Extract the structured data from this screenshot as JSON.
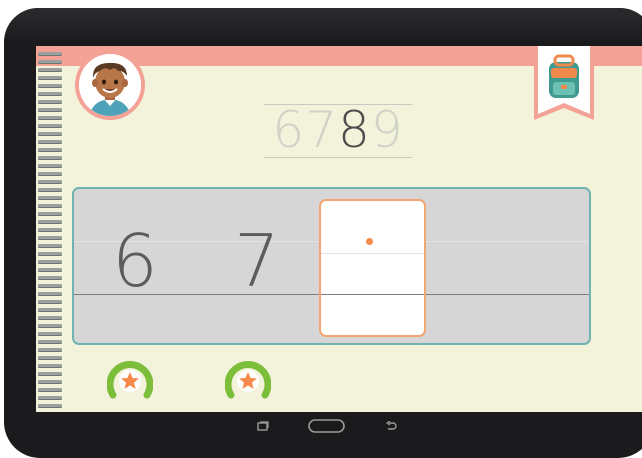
{
  "sequence": {
    "digits": [
      "6",
      "7",
      "8",
      "9"
    ],
    "current_index": 2
  },
  "writing": {
    "written": [
      "6",
      "7"
    ],
    "target_digit": "8"
  },
  "stars": {
    "earned": 2
  },
  "nav": {
    "buttons": [
      "recent-apps",
      "home",
      "back"
    ]
  },
  "icons": {
    "avatar": "boy-avatar-icon",
    "backpack": "backpack-icon",
    "star": "star-icon"
  },
  "colors": {
    "header_band": "#f4a196",
    "screen_bg": "#f3f2da",
    "panel_border": "#6fb4b0",
    "tracebox_border": "#f3a574",
    "star_ring": "#7cbd3a",
    "star_fill": "#f58a4b"
  }
}
